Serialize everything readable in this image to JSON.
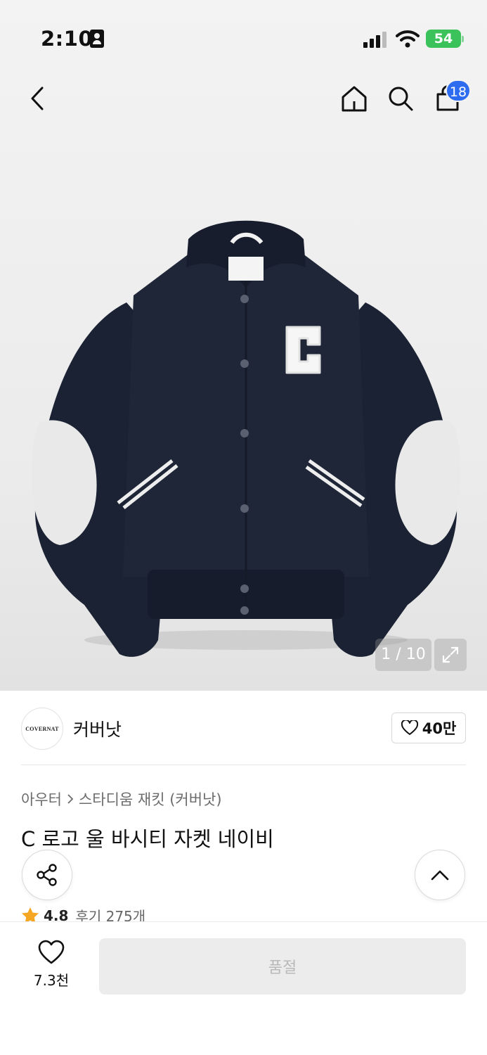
{
  "status_bar": {
    "time": "2:10",
    "battery": "54"
  },
  "header": {
    "cart_count": "18",
    "icons": [
      "back-icon",
      "home-icon",
      "search-icon",
      "cart-icon"
    ]
  },
  "gallery": {
    "counter": "1 / 10"
  },
  "brand": {
    "logo_text": "COVERNAT",
    "name": "커버낫",
    "likes": "40만"
  },
  "product": {
    "breadcrumb": [
      "아우터",
      "스타디움 재킷 (커버낫)"
    ],
    "title": "C 로고 울 바시티 자켓 네이비",
    "rating": "4.8",
    "reviews": "후기 275개"
  },
  "bottom_bar": {
    "wish_count": "7.3천",
    "soldout_label": "품절"
  },
  "colors": {
    "accent_badge": "#2d6cf0",
    "battery": "#3bc25a",
    "star": "#f5a623",
    "jacket": "#1b2233"
  }
}
